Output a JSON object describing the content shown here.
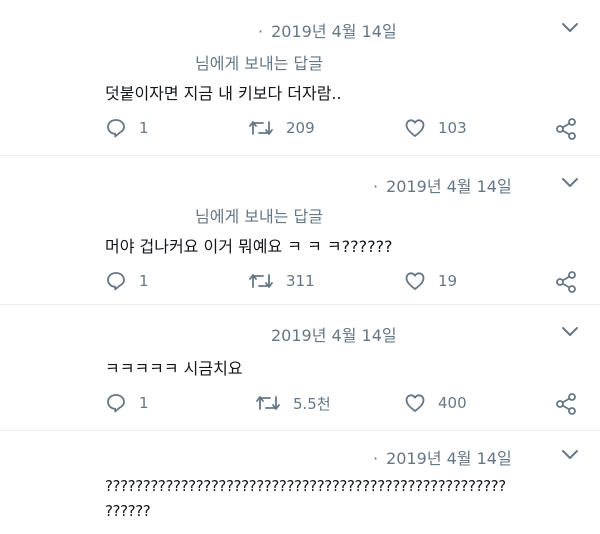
{
  "tweets": [
    {
      "dot": "·",
      "date": "2019년 4월 14일",
      "reply_to": "님에게 보내는 답글",
      "text": "덧붙이자면 지금 내 키보다 더자람..",
      "reply_count": "1",
      "retweet_count": "209",
      "like_count": "103"
    },
    {
      "dot": "·",
      "date": "2019년 4월 14일",
      "reply_to": "님에게 보내는 답글",
      "text": "머야 겁나커요 이거 뭐예요 ㅋ ㅋ ㅋ??????",
      "reply_count": "1",
      "retweet_count": "311",
      "like_count": "19"
    },
    {
      "dot": "",
      "date": "2019년 4월 14일",
      "text": "ㅋㅋㅋㅋㅋ 시금치요",
      "reply_count": "1",
      "retweet_count": "5.5천",
      "like_count": "400"
    },
    {
      "dot": "·",
      "date": "2019년 4월 14일",
      "text_line1": "?????????????????????????????????????????????????????",
      "text_line2": "??????"
    }
  ],
  "icons": {
    "reply": "reply-icon",
    "retweet": "retweet-icon",
    "like": "heart-icon",
    "share": "share-icon",
    "more": "chevron-down-icon"
  },
  "colors": {
    "text": "#14171a",
    "secondary": "#657786",
    "divider": "#e6ecf0"
  }
}
